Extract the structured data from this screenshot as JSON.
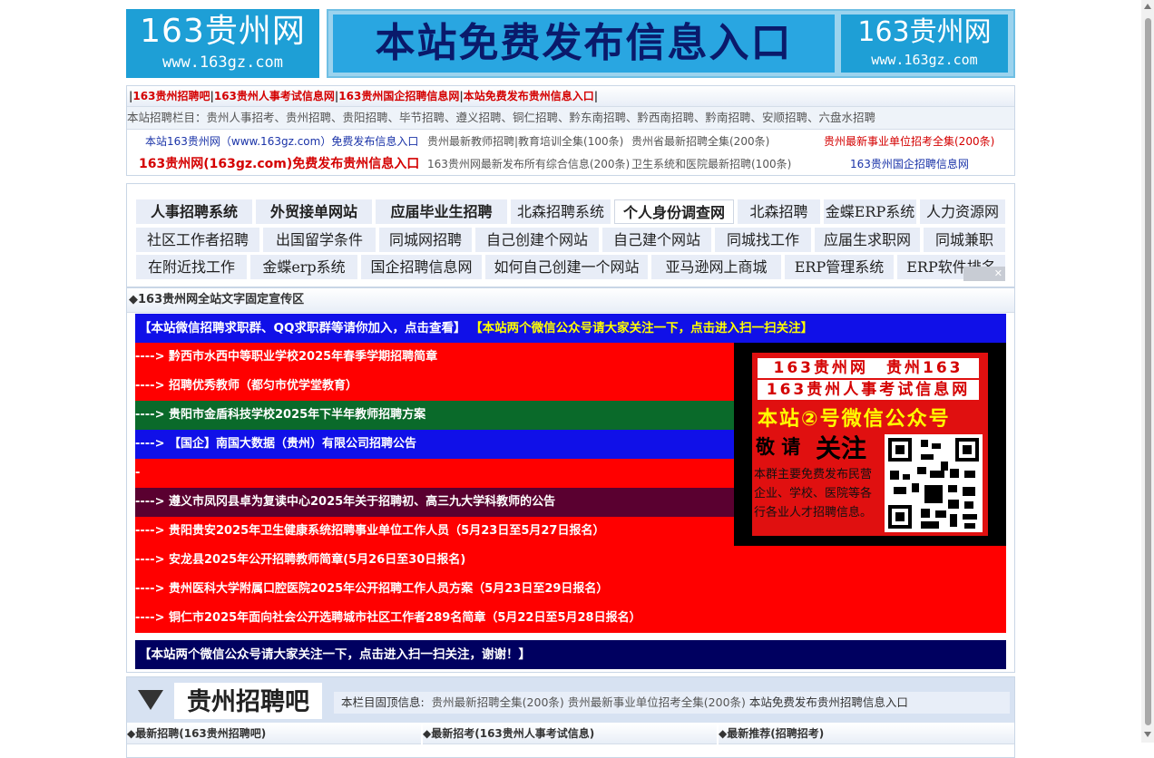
{
  "header": {
    "logo_title": "163贵州网",
    "logo_url": "www.163gz.com",
    "banner_text": "本站免费发布信息入口",
    "banner_logo_title": "163贵州网",
    "banner_logo_url": "www.163gz.com"
  },
  "quicklinks": {
    "row1": [
      "163贵州招聘吧",
      "163贵州人事考试信息网",
      "163贵州国企招聘信息网",
      "本站免费发布贵州信息入口"
    ],
    "row2_prefix": "本站招聘栏目：",
    "row2": "贵州人事招考、贵州招聘、贵阳招聘、毕节招聘、遵义招聘、铜仁招聘、黔东南招聘、黔西南招聘、黔南招聘、安顺招聘、六盘水招聘",
    "row3": [
      "本站163贵州网（www.163gz.com）免费发布信息入口",
      "贵州最新教师招聘|教育培训全集(100条)",
      "贵州省最新招聘全集(200条)",
      "贵州最新事业单位招考全集(200条)"
    ],
    "row4": [
      "163贵州网(163gz.com)免费发布贵州信息入口",
      "163贵州网最新发布所有综合信息(200条)",
      "卫生系统和医院最新招聘(100条)",
      "163贵州国企招聘信息网"
    ]
  },
  "keywords": {
    "row1": [
      "人事招聘系统",
      "外贸接单网站",
      "应届毕业生招聘",
      "北森招聘系统",
      "个人身份调查网",
      "北森招聘",
      "金蝶ERP系统",
      "人力资源网"
    ],
    "row2": [
      "社区工作者招聘",
      "出国留学条件",
      "同城网招聘",
      "自己创建个网站",
      "自己建个网站",
      "同城找工作",
      "应届生求职网",
      "同城兼职"
    ],
    "row3": [
      "在附近找工作",
      "金蝶erp系统",
      "国企招聘信息网",
      "如何自己创建一个网站",
      "亚马逊网上商城",
      "ERP管理系统",
      "ERP软件排名"
    ],
    "ad_close": "✕"
  },
  "promo": {
    "title": "◆163贵州网全站文字固定宣传区",
    "top_white": "【本站微信招聘求职群、QQ求职群等请你加入，点击查看】",
    "top_yellow": "【本站两个微信公众号请大家关注一下，点击进入扫一扫关注】",
    "news": [
      {
        "text": "----> 黔西市水西中等职业学校2025年春季学期招聘简章",
        "bg": "#ff0000"
      },
      {
        "text": "----> 招聘优秀教师（都匀市优学堂教育）",
        "bg": "#ff0000"
      },
      {
        "text": "----> 贵阳市金盾科技学校2025年下半年教师招聘方案",
        "bg": "#0a6a2a"
      },
      {
        "text": "----> 【国企】南国大数据（贵州）有限公司招聘公告",
        "bg": "#1010e8"
      },
      {
        "text": "-",
        "bg": "#ff0000"
      },
      {
        "text": "----> 遵义市凤冈县卓为复读中心2025年关于招聘初、高三九大学科教师的公告",
        "bg": "#5a0030"
      },
      {
        "text": "----> 贵阳贵安2025年卫生健康系统招聘事业单位工作人员（5月23日至5月27日报名）",
        "bg": "#ff0000"
      },
      {
        "text": "----> 安龙县2025年公开招聘教师简章(5月26日至30日报名)",
        "bg": "#ff0000"
      },
      {
        "text": "----> 贵州医科大学附属口腔医院2025年公开招聘工作人员方案（5月23日至29日报名）",
        "bg": "#ff0000"
      },
      {
        "text": "----> 铜仁市2025年面向社会公开选聘城市社区工作者289名简章（5月22日至5月28日报名）",
        "bg": "#ff0000"
      }
    ],
    "bottom": "【本站两个微信公众号请大家关注一下，点击进入扫一扫关注，谢谢！】",
    "wechat": {
      "line1": "163贵州网　贵州163",
      "line2": "163贵州人事考试信息网",
      "title": "本站②号微信公众号",
      "invite": "敬 请",
      "follow": "关注",
      "desc": "本群主要免费发布民营企业、学校、医院等各行各业人才招聘信息。"
    }
  },
  "recruit": {
    "title": "贵州招聘吧",
    "info_prefix": "本栏目固顶信息:",
    "info_links": [
      "贵州最新招聘全集(200条)",
      "贵州最新事业单位招考全集(200条)",
      "本站免费发布贵州招聘信息入口"
    ],
    "columns": [
      "◆最新招聘(163贵州招聘吧)",
      "◆最新招考(163贵州人事考试信息)",
      "◆最新推荐(招聘招考)"
    ]
  }
}
